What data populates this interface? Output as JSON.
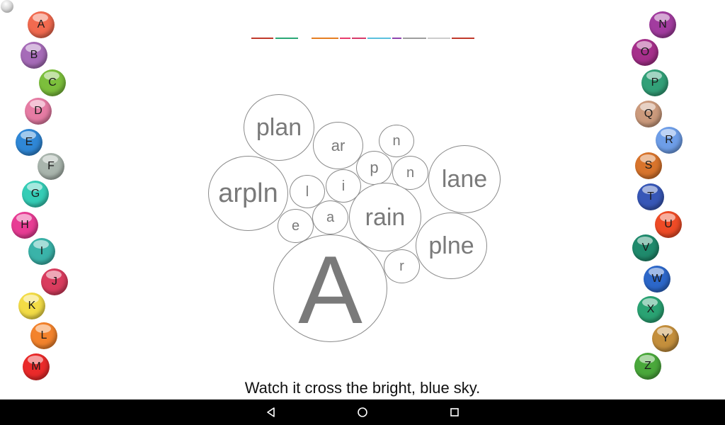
{
  "sentence": "Watch it cross the bright, blue sky.",
  "colors": {
    "bubble_border": "#8a8a8a",
    "bubble_text": "#7a7a7a",
    "navbar": "#000000"
  },
  "letters_left": [
    {
      "letter": "A",
      "color": "#f26a4f"
    },
    {
      "letter": "B",
      "color": "#a66bb8"
    },
    {
      "letter": "C",
      "color": "#7cbf3c"
    },
    {
      "letter": "D",
      "color": "#e67ca4"
    },
    {
      "letter": "E",
      "color": "#2f87d6"
    },
    {
      "letter": "F",
      "color": "#a9b5ad"
    },
    {
      "letter": "G",
      "color": "#35cdb6"
    },
    {
      "letter": "H",
      "color": "#e83c94"
    },
    {
      "letter": "I",
      "color": "#3ab3a9"
    },
    {
      "letter": "J",
      "color": "#d93c5e"
    },
    {
      "letter": "K",
      "color": "#f3dc46"
    },
    {
      "letter": "L",
      "color": "#f3832c"
    },
    {
      "letter": "M",
      "color": "#ea2a2a"
    }
  ],
  "letters_right": [
    {
      "letter": "N",
      "color": "#a23c9f"
    },
    {
      "letter": "O",
      "color": "#a62f8b"
    },
    {
      "letter": "P",
      "color": "#32a078"
    },
    {
      "letter": "Q",
      "color": "#cb9a7c"
    },
    {
      "letter": "R",
      "color": "#6e9ee8"
    },
    {
      "letter": "S",
      "color": "#d8742c"
    },
    {
      "letter": "T",
      "color": "#3757b7"
    },
    {
      "letter": "U",
      "color": "#ee4b26"
    },
    {
      "letter": "V",
      "color": "#1f8a6c"
    },
    {
      "letter": "W",
      "color": "#2c67c9"
    },
    {
      "letter": "X",
      "color": "#2aa373"
    },
    {
      "letter": "Y",
      "color": "#c48f3c"
    },
    {
      "letter": "Z",
      "color": "#4aa83b"
    }
  ],
  "progress_segments": [
    {
      "color": "#c0392b"
    },
    {
      "color": "#2aa876"
    },
    {
      "color": "#e67e22"
    },
    {
      "color": "#e83c6c"
    },
    {
      "color": "#d63a6a"
    },
    {
      "color": "#5bc0de"
    },
    {
      "color": "#8e44ad"
    },
    {
      "color": "#9e9e9e"
    },
    {
      "color": "#cccccc"
    },
    {
      "color": "#c0392b"
    }
  ],
  "bubbles": [
    {
      "id": "plan",
      "text": "plan"
    },
    {
      "id": "ar",
      "text": "ar"
    },
    {
      "id": "n1",
      "text": "n"
    },
    {
      "id": "arpln",
      "text": "arpln"
    },
    {
      "id": "l",
      "text": "l"
    },
    {
      "id": "i",
      "text": "i"
    },
    {
      "id": "p",
      "text": "p"
    },
    {
      "id": "n2",
      "text": "n"
    },
    {
      "id": "lane",
      "text": "lane"
    },
    {
      "id": "e",
      "text": "e"
    },
    {
      "id": "a",
      "text": "a"
    },
    {
      "id": "rain",
      "text": "rain"
    },
    {
      "id": "plne",
      "text": "plne"
    },
    {
      "id": "r",
      "text": "r"
    },
    {
      "id": "A",
      "text": "A"
    }
  ]
}
